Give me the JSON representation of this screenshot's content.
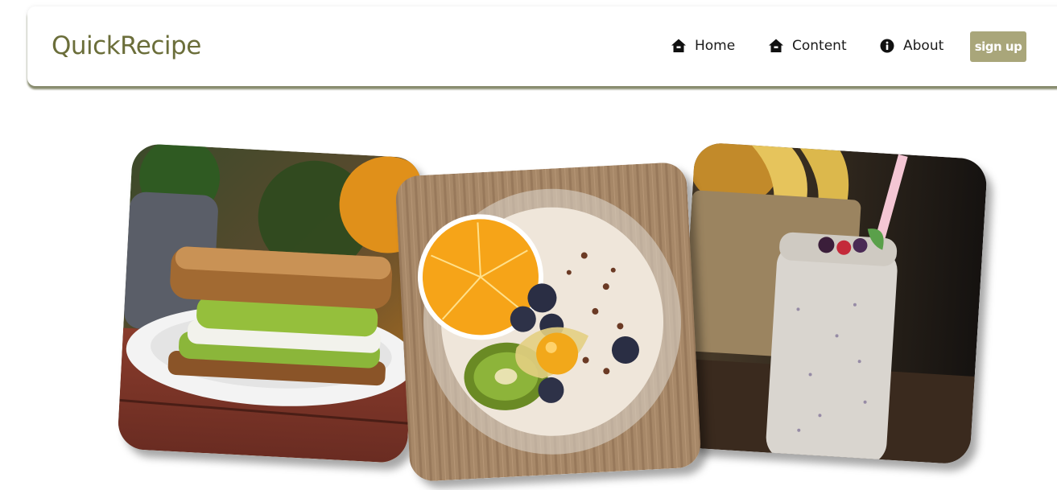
{
  "header": {
    "brand": "QuickRecipe",
    "nav": [
      {
        "label": "Home",
        "icon": "home-icon"
      },
      {
        "label": "Content",
        "icon": "home-icon"
      },
      {
        "label": "About",
        "icon": "info-icon"
      }
    ],
    "signup_label": "sign up"
  },
  "gallery": {
    "images": [
      {
        "subject": "avocado sandwich",
        "icon": "sandwich-photo"
      },
      {
        "subject": "oatmeal bowl with fruit",
        "icon": "oatmeal-photo"
      },
      {
        "subject": "berry smoothie in jar",
        "icon": "smoothie-photo"
      }
    ]
  },
  "colors": {
    "brand": "#6b6e3a",
    "accent": "#a9a67a",
    "shadow": "#5f643c"
  }
}
